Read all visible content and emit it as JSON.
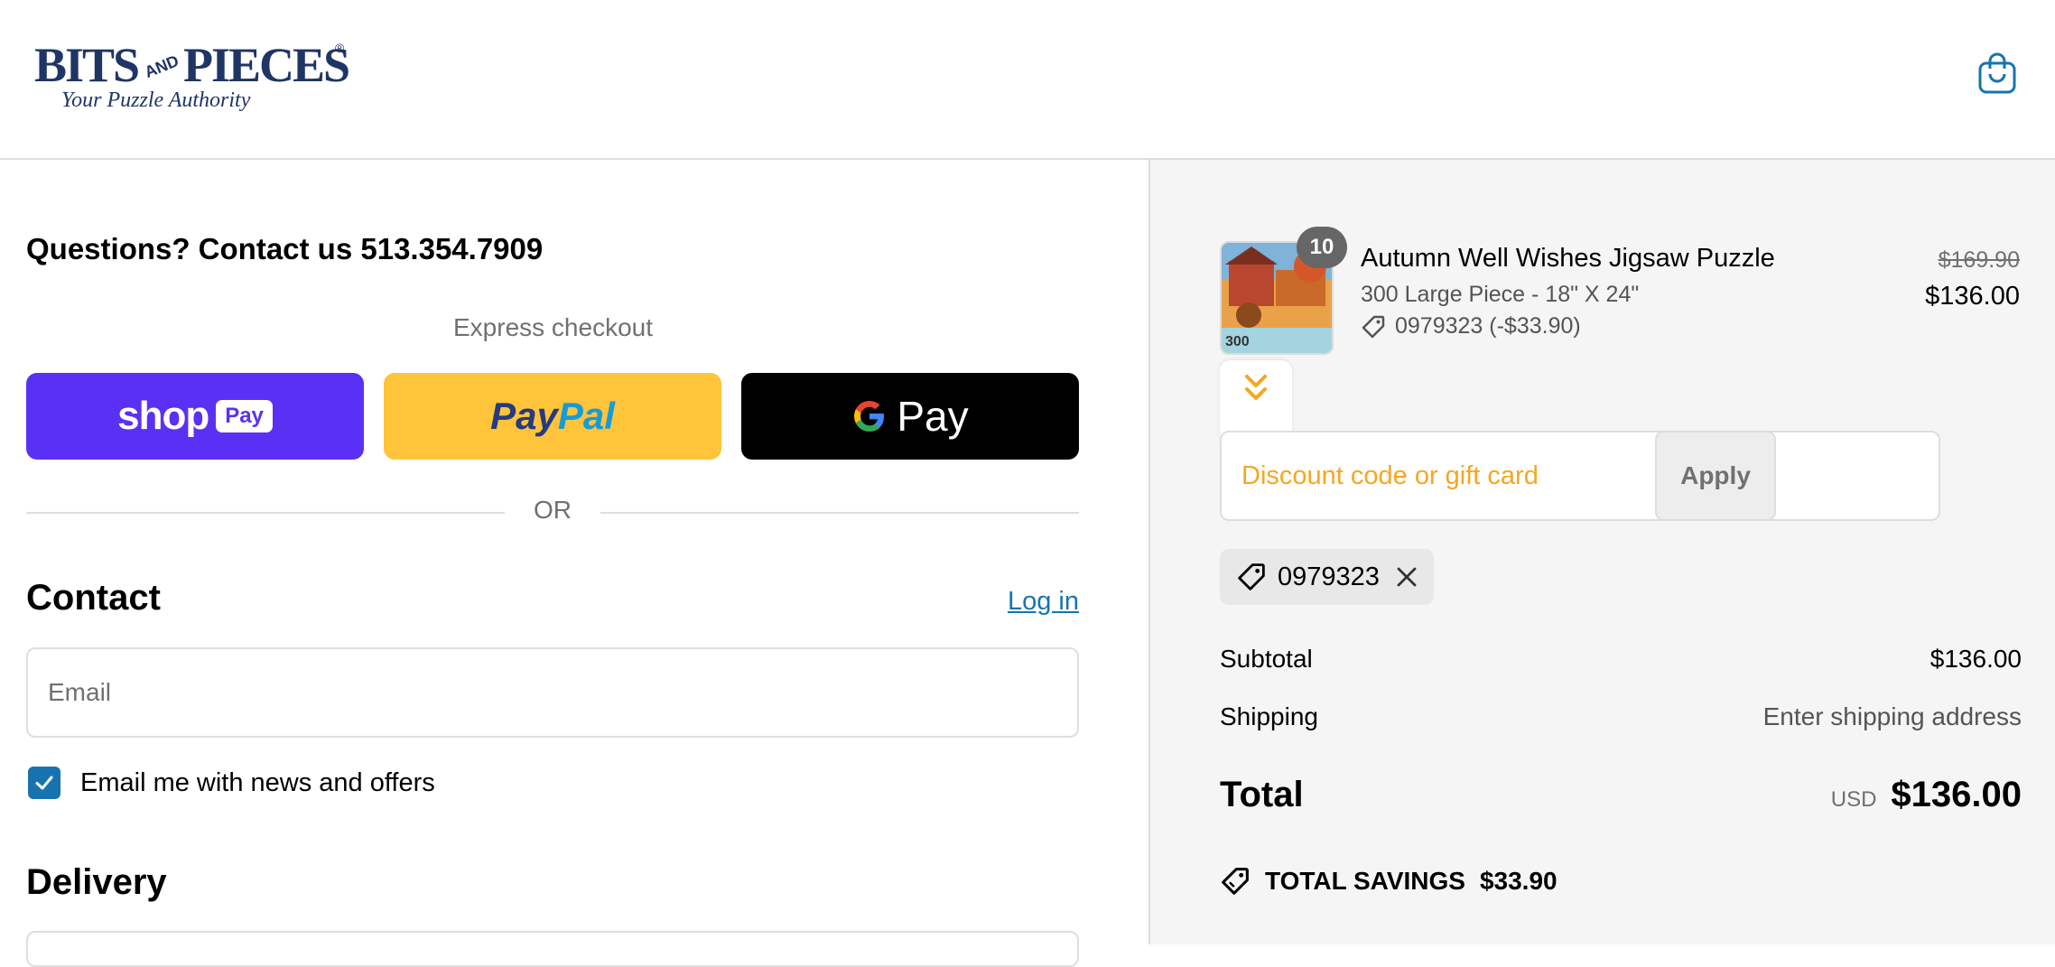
{
  "header": {
    "logo_top": "BITS",
    "logo_and": "AND",
    "logo_pieces": "PIECES",
    "logo_tagline": "Your Puzzle Authority",
    "cart_icon": "shopping-bag-icon"
  },
  "main": {
    "contact_question": "Questions? Contact us 513.354.7909",
    "express_title": "Express checkout",
    "shop_pay": {
      "word": "shop",
      "pill": "Pay"
    },
    "paypal": {
      "word1": "Pay",
      "word2": "Pal"
    },
    "gpay": {
      "word": "Pay"
    },
    "or_text": "OR",
    "contact_heading": "Contact",
    "login_label": "Log in",
    "email_placeholder": "Email",
    "news_label": "Email me with news and offers",
    "news_checked": true,
    "delivery_heading": "Delivery"
  },
  "summary": {
    "product": {
      "quantity": "10",
      "name": "Autumn Well Wishes Jigsaw Puzzle",
      "variant": "300 Large Piece - 18\" X 24\"",
      "discount": "0979323 (-$33.90)",
      "price_original": "$169.90",
      "price_final": "$136.00",
      "thumb_count": "300"
    },
    "discount_placeholder": "Discount code or gift card",
    "apply_label": "Apply",
    "applied_code": "0979323",
    "subtotal_label": "Subtotal",
    "subtotal_value": "$136.00",
    "shipping_label": "Shipping",
    "shipping_value": "Enter shipping address",
    "total_label": "Total",
    "currency": "USD",
    "total_value": "$136.00",
    "savings_label": "TOTAL SAVINGS",
    "savings_value": "$33.90"
  },
  "colors": {
    "shop_pay": "#5a31f4",
    "paypal": "#ffc439",
    "link": "#1773b0",
    "accent_orange": "#f5a623"
  }
}
